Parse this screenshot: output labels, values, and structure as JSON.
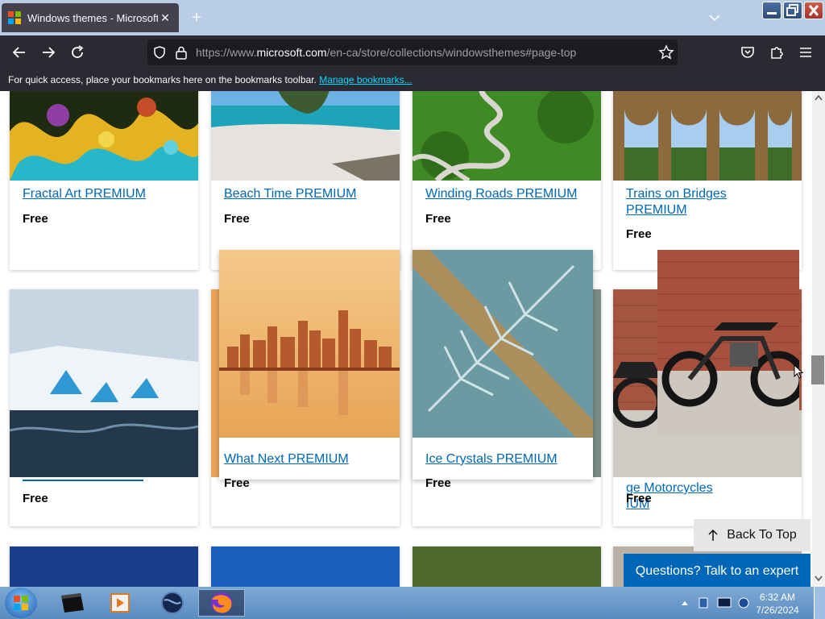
{
  "browser": {
    "tab_title": "Windows themes - Microsoft St",
    "url_prefix": "https://www.",
    "url_host": "microsoft.com",
    "url_path": "/en-ca/store/collections/windowsthemes#page-top",
    "bookmarks_message": "For quick access, place your bookmarks here on the bookmarks toolbar.",
    "bookmarks_link": "Manage bookmarks..."
  },
  "cards": [
    {
      "title": "Fractal Art PREMIUM",
      "price": "Free"
    },
    {
      "title": "Beach Time PREMIUM",
      "price": "Free"
    },
    {
      "title": "Winding Roads PREMIUM",
      "price": "Free"
    },
    {
      "title": "Trains on Bridges",
      "title2": "PREMIUM",
      "price": "Free"
    },
    {
      "title": "",
      "price": "Free"
    },
    {
      "title": "What Next PREMIUM",
      "price": "Free"
    },
    {
      "title": "Ice Crystals PREMIUM",
      "price": "Free"
    },
    {
      "title": "ge Motorcycles",
      "title2": "IUM",
      "price": "Free"
    }
  ],
  "back_to_top": "Back To Top",
  "expert_button": "Questions? Talk to an expert",
  "taskbar": {
    "time": "6:32 AM",
    "date": "7/26/2024"
  },
  "icons": {
    "back": "arrow-left-icon",
    "forward": "arrow-right-icon",
    "reload": "reload-icon",
    "shield": "shield-icon",
    "lock": "lock-icon",
    "star": "star-icon",
    "pocket": "pocket-icon",
    "extensions": "puzzle-icon",
    "menu": "hamburger-icon"
  }
}
